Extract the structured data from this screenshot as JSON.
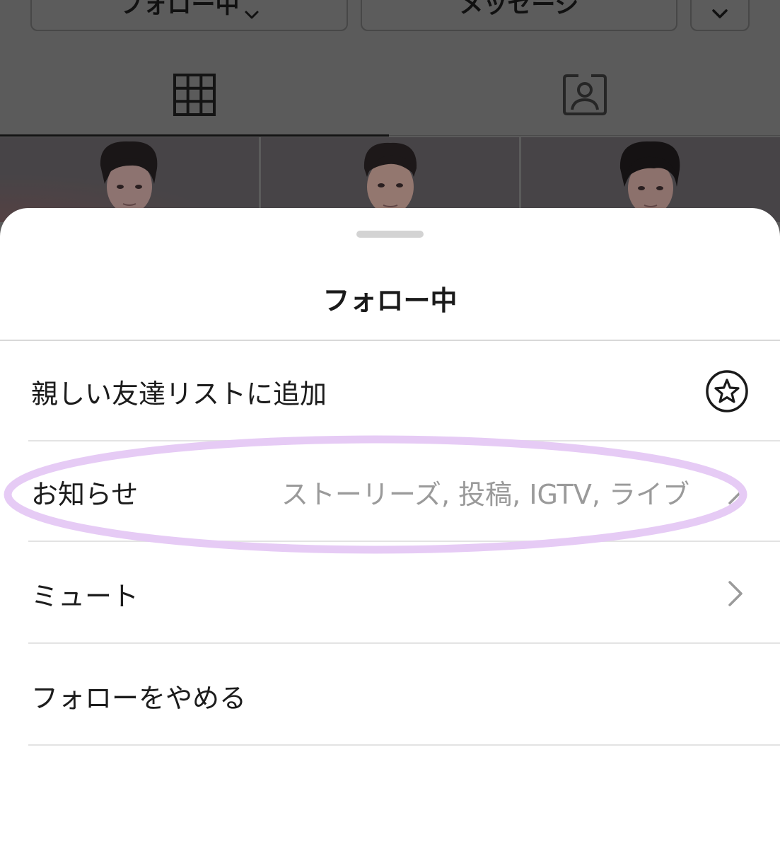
{
  "profile": {
    "following_button_label": "フォロー中",
    "message_button_label": "メッセージ",
    "more_icon": "chevron-down-icon",
    "tabs": [
      {
        "name": "grid",
        "icon": "grid-icon",
        "active": true
      },
      {
        "name": "tagged",
        "icon": "tagged-person-icon",
        "active": false
      }
    ]
  },
  "sheet": {
    "title": "フォロー中",
    "items": [
      {
        "label": "親しい友達リストに追加",
        "detail": "",
        "icon": "star-circle-icon"
      },
      {
        "label": "お知らせ",
        "detail": "ストーリーズ, 投稿, IGTV, ライブ",
        "icon": "chevron-right-icon"
      },
      {
        "label": "ミュート",
        "detail": "",
        "icon": "chevron-right-icon"
      },
      {
        "label": "フォローをやめる",
        "detail": "",
        "icon": ""
      }
    ]
  },
  "annotation": {
    "highlight_color": "#e6cbf5"
  }
}
